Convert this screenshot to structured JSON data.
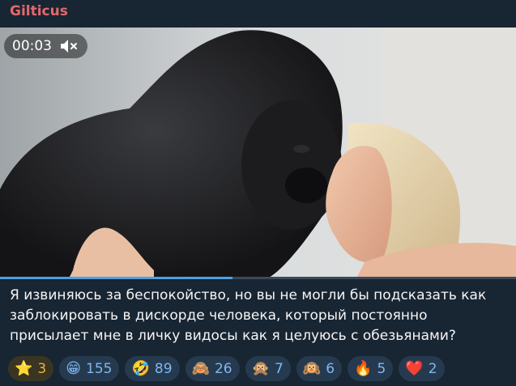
{
  "message": {
    "sender": "Gilticus",
    "video": {
      "time": "00:03",
      "progress": 0.45
    },
    "caption": "Я извиняюсь за беспокойство, но вы не могли бы подсказать как заблокировать в дискорде человека, который постоянно присылает мне в личку видосы как я целуюсь с обезьянами?",
    "reactions": [
      {
        "icon": "star-icon",
        "emoji": "⭐",
        "count": "3",
        "paid": true
      },
      {
        "icon": "grin-icon",
        "emoji": "😁",
        "count": "155"
      },
      {
        "icon": "rofl-icon",
        "emoji": "🤣",
        "count": "89"
      },
      {
        "icon": "see-no-evil-monkey-icon",
        "emoji": "🙈",
        "count": "26"
      },
      {
        "icon": "speak-no-evil-monkey-icon",
        "emoji": "🙊",
        "count": "7"
      },
      {
        "icon": "hear-no-evil-monkey-icon",
        "emoji": "🙉",
        "count": "6"
      },
      {
        "icon": "fire-icon",
        "emoji": "🔥",
        "count": "5"
      },
      {
        "icon": "heart-icon",
        "emoji": "❤️",
        "count": "2"
      }
    ]
  }
}
